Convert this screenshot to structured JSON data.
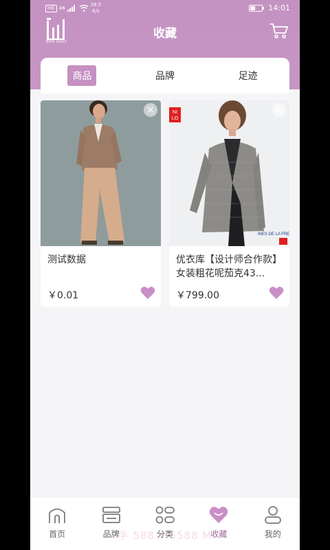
{
  "status_bar": {
    "hd": "HD",
    "signal": "46",
    "net_speed": "28.5",
    "net_unit": "K/s",
    "time": "14:01",
    "battery_level": 0.35
  },
  "header": {
    "logo_caption": "BENI DAILY",
    "title": "收藏",
    "cart_icon": "cart-icon"
  },
  "tabs": [
    {
      "label": "商品",
      "active": true
    },
    {
      "label": "品牌",
      "active": false
    },
    {
      "label": "足迹",
      "active": false
    }
  ],
  "products": [
    {
      "name": "测试数据",
      "price": "￥0.01"
    },
    {
      "name": "优衣库【设计师合作款】女装粗花呢茄克43...",
      "price": "￥799.00",
      "brand_badge": "UNI QLO",
      "tag_text": "INES DE LA FRE"
    }
  ],
  "bottom_nav": [
    {
      "label": "首页",
      "icon": "home-icon",
      "active": false
    },
    {
      "label": "品牌",
      "icon": "brand-icon",
      "active": false
    },
    {
      "label": "分类",
      "icon": "category-icon",
      "active": false
    },
    {
      "label": "收藏",
      "icon": "heart-icon",
      "active": true
    },
    {
      "label": "我的",
      "icon": "user-icon",
      "active": false
    }
  ],
  "watermark": "手 588 • 5588 M",
  "colors": {
    "brand": "#c590c2",
    "heart": "#c98fc6",
    "background": "#f5f5f7"
  }
}
